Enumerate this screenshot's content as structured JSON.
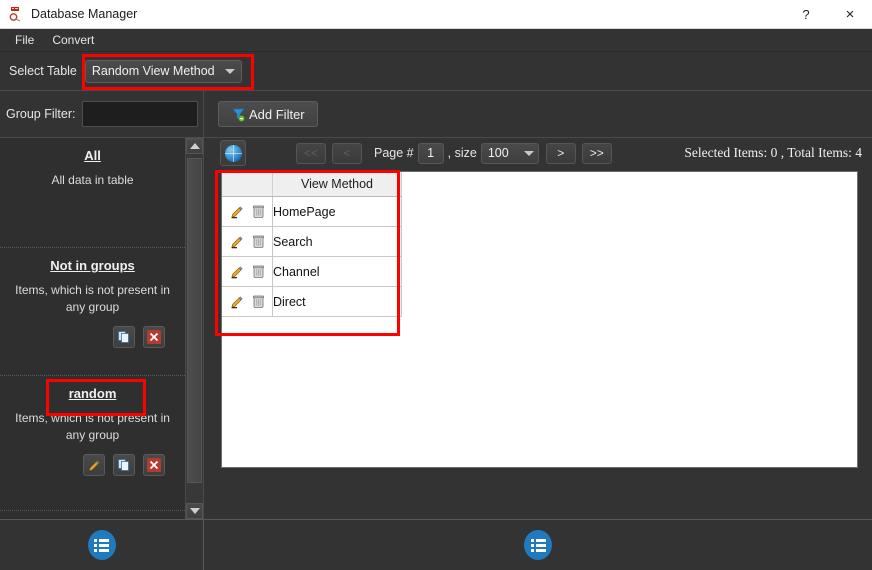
{
  "window": {
    "title": "Database Manager",
    "app_icon": "database-icon",
    "help_label": "?",
    "close_label": "×"
  },
  "menubar": {
    "items": [
      {
        "label": "File",
        "name": "menu-file"
      },
      {
        "label": "Convert",
        "name": "menu-convert"
      }
    ]
  },
  "select_table": {
    "label": "Select Table",
    "value": "Random View Method",
    "highlighted": true
  },
  "filters": {
    "group_filter_label": "Group Filter:",
    "group_filter_value": "",
    "group_filter_placeholder": "",
    "add_filter_label": "Add Filter",
    "add_filter_icon": "funnel-icon"
  },
  "sidebar": {
    "groups": [
      {
        "title": "All",
        "description": "All data in table",
        "actions": [],
        "highlighted": false
      },
      {
        "title": "Not in groups",
        "description": "Items, which is not present in any group",
        "actions": [
          "copy-icon",
          "delete-icon"
        ],
        "highlighted": false
      },
      {
        "title": "random",
        "description": "Items, which is not present in any group",
        "actions": [
          "edit-icon",
          "copy-icon",
          "delete-icon"
        ],
        "highlighted": true
      }
    ],
    "scrollbar": {
      "up_arrow": "chevron-up-icon",
      "down_arrow": "chevron-down-icon"
    }
  },
  "pager": {
    "refresh_icon": "globe-refresh-icon",
    "first_label": "<<",
    "prev_label": "<",
    "page_label": "Page #",
    "page_value": "1",
    "size_label": ", size",
    "size_value": "100",
    "next_label": ">",
    "last_label": ">>",
    "first_enabled": false,
    "prev_enabled": false,
    "status": "Selected Items: 0 , Total Items: 4"
  },
  "table": {
    "columns": [
      "",
      "View Method"
    ],
    "row_actions": [
      "edit-icon",
      "delete-icon"
    ],
    "rows": [
      {
        "view_method": "HomePage"
      },
      {
        "view_method": "Search"
      },
      {
        "view_method": "Channel"
      },
      {
        "view_method": "Direct"
      }
    ]
  },
  "bottombar": {
    "left_icon": "list-icon",
    "right_icon": "list-icon"
  },
  "colors": {
    "annotation": "#ff0000",
    "window_bg": "#333333",
    "panel_bg": "#ffffff",
    "accent_blue": "#1f7ac0"
  }
}
